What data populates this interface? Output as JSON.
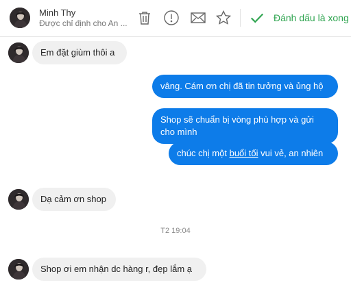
{
  "header": {
    "contact_name": "Minh Thy",
    "assigned_to": "Được chỉ định cho An ...",
    "actions": {
      "delete_icon": "trash-icon",
      "spam_icon": "alert-circle-icon",
      "mail_icon": "envelope-icon",
      "star_icon": "star-icon",
      "mark_done_label": "Đánh dấu là xong",
      "mark_done_icon": "checkmark-icon"
    }
  },
  "conversation": {
    "messages": [
      {
        "direction": "incoming",
        "text": "Em đặt giùm thôi a"
      },
      {
        "direction": "outgoing",
        "text": "vâng. Cám ơn chị đã tin tưởng và ủng hộ"
      },
      {
        "direction": "outgoing",
        "text": "Shop sẽ chuẩn bị vòng phù hợp và gửi cho mình"
      },
      {
        "direction": "outgoing",
        "text_before": "chúc chị một ",
        "link_text": "buổi tối",
        "text_after": " vui vẻ, an nhiên"
      },
      {
        "direction": "incoming",
        "text": "Dạ cảm ơn shop"
      },
      {
        "direction": "incoming",
        "text": "Shop ơi em nhận dc hàng r, đẹp lắm ạ"
      }
    ],
    "timestamp": "T2 19:04"
  },
  "colors": {
    "outgoing_bubble": "#0d7ce9",
    "incoming_bubble": "#f0f0f0",
    "done_green": "#2ea44f"
  }
}
